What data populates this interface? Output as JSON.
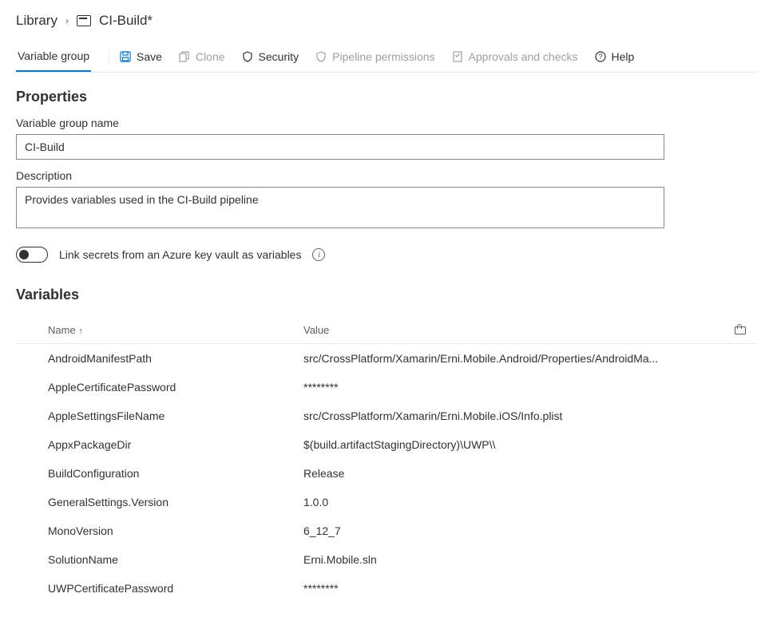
{
  "breadcrumb": {
    "root": "Library",
    "current": "CI-Build*"
  },
  "tabs": {
    "active": "Variable group"
  },
  "commands": {
    "save": "Save",
    "clone": "Clone",
    "security": "Security",
    "pipeline_permissions": "Pipeline permissions",
    "approvals": "Approvals and checks",
    "help": "Help"
  },
  "properties": {
    "title": "Properties",
    "name_label": "Variable group name",
    "name_value": "CI-Build",
    "desc_label": "Description",
    "desc_value": "Provides variables used in the CI-Build pipeline",
    "toggle_label": "Link secrets from an Azure key vault as variables"
  },
  "variables": {
    "title": "Variables",
    "header_name": "Name",
    "header_value": "Value",
    "rows": [
      {
        "name": "AndroidManifestPath",
        "value": "src/CrossPlatform/Xamarin/Erni.Mobile.Android/Properties/AndroidMa..."
      },
      {
        "name": "AppleCertificatePassword",
        "value": "********"
      },
      {
        "name": "AppleSettingsFileName",
        "value": "src/CrossPlatform/Xamarin/Erni.Mobile.iOS/Info.plist"
      },
      {
        "name": "AppxPackageDir",
        "value": "$(build.artifactStagingDirectory)\\UWP\\\\"
      },
      {
        "name": "BuildConfiguration",
        "value": "Release"
      },
      {
        "name": "GeneralSettings.Version",
        "value": "1.0.0"
      },
      {
        "name": "MonoVersion",
        "value": "6_12_7"
      },
      {
        "name": "SolutionName",
        "value": "Erni.Mobile.sln"
      },
      {
        "name": "UWPCertificatePassword",
        "value": "********"
      }
    ]
  }
}
